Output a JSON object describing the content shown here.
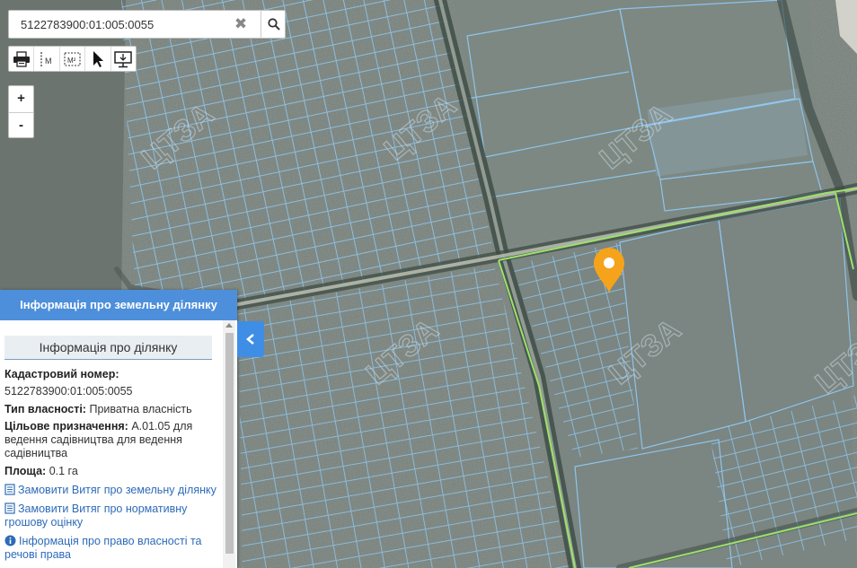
{
  "search": {
    "value": "5122783900:01:005:0055",
    "clear_icon": "close-icon",
    "search_icon": "search-icon"
  },
  "toolbar": {
    "tools": [
      {
        "name": "print-tool",
        "icon": "printer-icon"
      },
      {
        "name": "measure-distance-tool",
        "icon": "ruler-icon",
        "label": "M"
      },
      {
        "name": "measure-area-tool",
        "icon": "area-icon",
        "label": "M²"
      },
      {
        "name": "select-tool",
        "icon": "cursor-icon"
      },
      {
        "name": "screen-tool",
        "icon": "monitor-icon"
      }
    ]
  },
  "zoom": {
    "in": "+",
    "out": "-"
  },
  "map": {
    "watermark": "ЦТЗА",
    "parcel_line_color": "#7fc8ff",
    "boundary_color": "#9ce26a",
    "marker_color": "#f5a31a"
  },
  "panel": {
    "title": "Інформація про земельну ділянку",
    "section_title": "Інформація про ділянку",
    "cadastral_label": "Кадастровий номер:",
    "cadastral_value": "5122783900:01:005:0055",
    "ownership_label": "Тип власності:",
    "ownership_value": "Приватна власність",
    "purpose_label": "Цільове призначення:",
    "purpose_value": "А.01.05 для ведення садівництва для ведення садівництва",
    "area_label": "Площа:",
    "area_value": "0.1 га",
    "links": [
      "Замовити Витяг про земельну ділянку",
      "Замовити Витяг про нормативну грошову оцінку",
      "Інформація про право власності та речові права"
    ]
  }
}
